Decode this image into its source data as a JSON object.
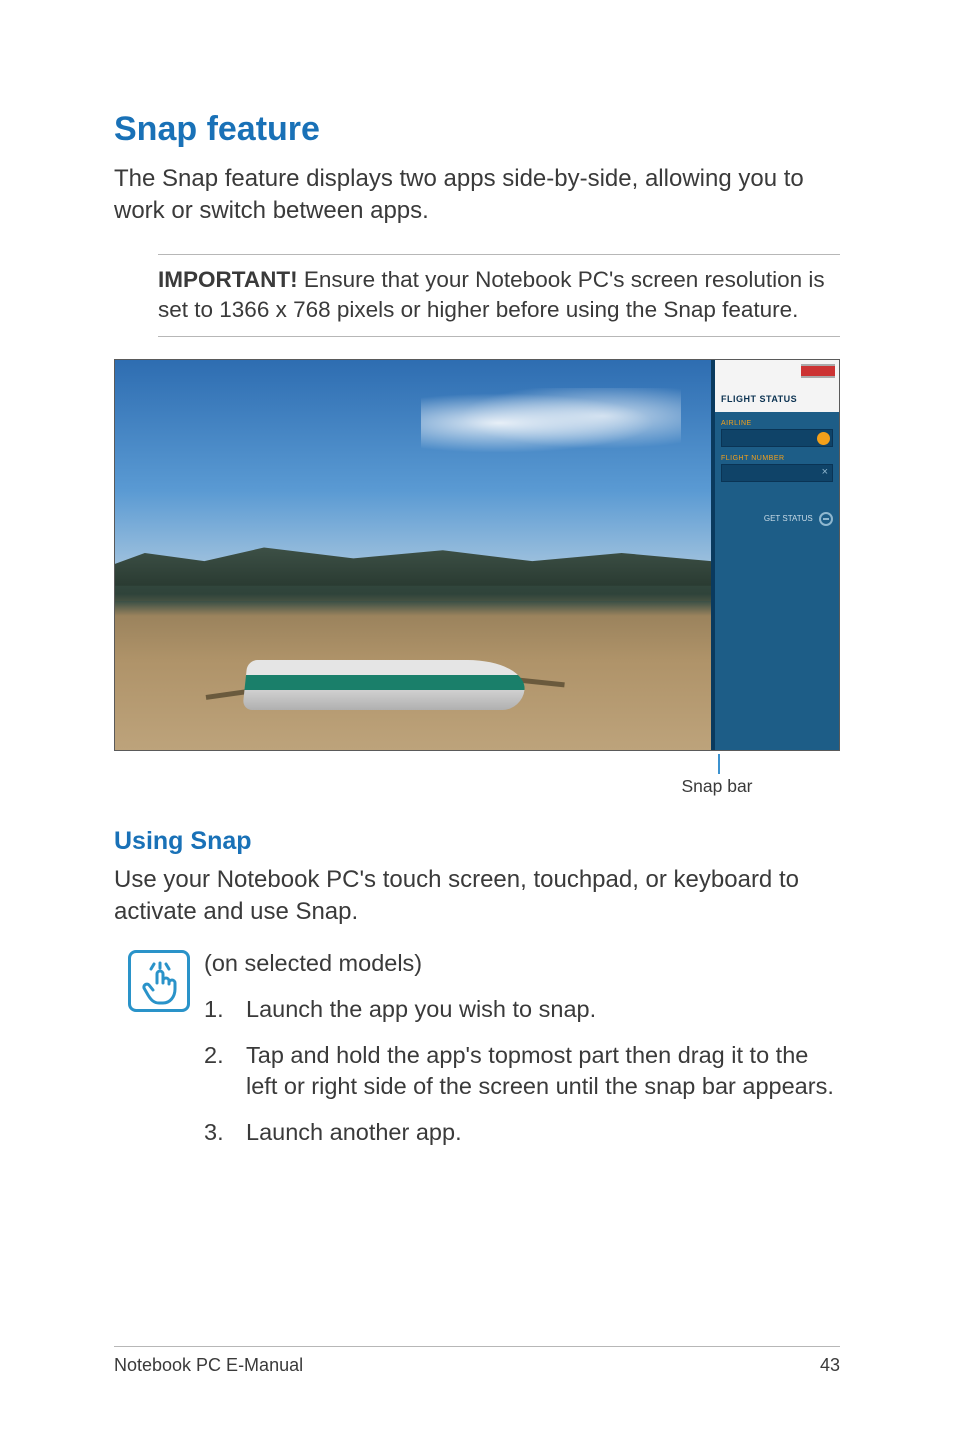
{
  "heading1": "Snap feature",
  "intro": "The Snap feature displays two apps side-by-side, allowing you to work or switch between apps.",
  "notice_label": "IMPORTANT!",
  "notice_text": " Ensure that your Notebook PC's screen resolution is set to 1366 x 768 pixels or higher before using the Snap feature.",
  "figure": {
    "side_app_title": "FLIGHT STATUS",
    "field1_label": "AIRLINE",
    "field2_label": "FLIGHT NUMBER",
    "status_label": "GET STATUS"
  },
  "callout": "Snap bar",
  "heading2": "Using Snap",
  "using_intro": "Use your Notebook PC's touch screen, touchpad, or keyboard to activate and use Snap.",
  "touch_note": "(on selected models)",
  "steps": {
    "s1_num": "1.",
    "s1_txt": "Launch the app you wish to snap.",
    "s2_num": "2.",
    "s2_txt": "Tap and hold the app's topmost part then drag it to the left or right side of the screen until the snap bar appears.",
    "s3_num": "3.",
    "s3_txt": "Launch another app."
  },
  "footer_left": "Notebook PC E-Manual",
  "footer_right": "43"
}
